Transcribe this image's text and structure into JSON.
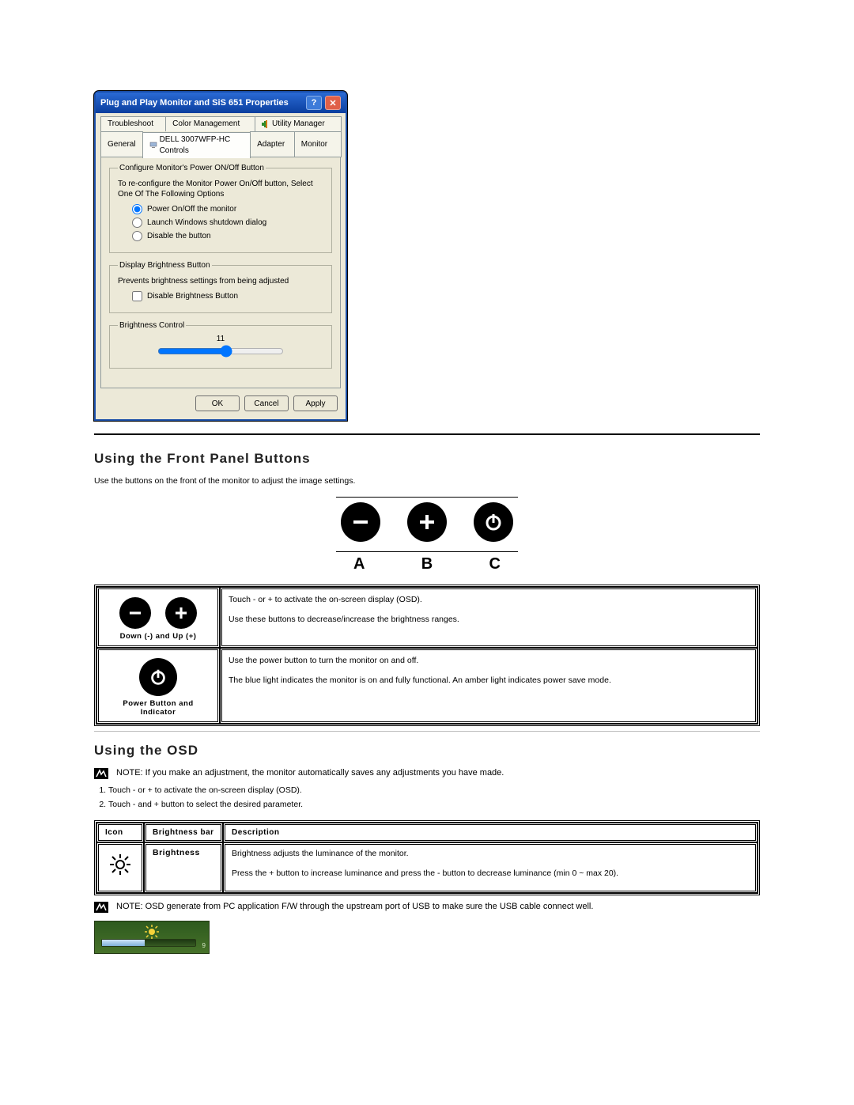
{
  "dialog": {
    "title": "Plug and Play Monitor and SiS 651 Properties",
    "tabs_top": [
      "Troubleshoot",
      "Color Management",
      "Utility Manager"
    ],
    "tabs_bottom": [
      "General",
      "DELL 3007WFP-HC Controls",
      "Adapter",
      "Monitor"
    ],
    "group1": {
      "legend": "Configure Monitor's Power ON/Off Button",
      "desc": "To re-configure the Monitor Power On/Off button, Select One Of The Following Options",
      "opt1": "Power On/Off the monitor",
      "opt2": "Launch Windows shutdown dialog",
      "opt3": "Disable the button"
    },
    "group2": {
      "legend": "Display Brightness Button",
      "desc": "Prevents brightness settings from being adjusted",
      "opt": "Disable Brightness Button"
    },
    "group3": {
      "legend": "Brightness Control",
      "value": "11"
    },
    "buttons": {
      "ok": "OK",
      "cancel": "Cancel",
      "apply": "Apply"
    }
  },
  "section1": {
    "heading": "Using the Front Panel Buttons",
    "intro": "Use the buttons on the front of the monitor to adjust the image settings.",
    "labels": {
      "a": "A",
      "b": "B",
      "c": "C"
    },
    "row1": {
      "caption": "Down (-) and Up (+)",
      "line1": "Touch - or + to activate the on-screen display (OSD).",
      "line2": "Use these buttons to decrease/increase the brightness ranges."
    },
    "row2": {
      "caption": "Power Button and Indicator",
      "line1": "Use the  power button to turn the monitor on and off.",
      "line2": "The blue light  indicates the monitor is on and fully functional. An amber light indicates power save mode."
    }
  },
  "section2": {
    "heading": "Using the OSD",
    "note1": "NOTE: If  you make an adjustment, the monitor automatically saves any adjustments you have made.",
    "step1": "Touch - or + to activate the on-screen display (OSD).",
    "step2": "Touch - and + button to select the desired parameter.",
    "table_headers": {
      "icon": "Icon",
      "bar": "Brightness bar",
      "desc": "Description"
    },
    "table_row": {
      "bar": "Brightness",
      "d1": "Brightness adjusts the  luminance of the monitor.",
      "d2": "Press  the + button to increase luminance and press  the - button to decrease luminance (min 0 ~ max 20)."
    },
    "note2": "NOTE: OSD generate from PC application F/W through the upstream port of USB to make sure the USB cable connect well.",
    "osd_value": "9"
  },
  "chart_data": {
    "type": "bar",
    "title": "Brightness OSD indicator",
    "categories": [
      "Brightness"
    ],
    "values": [
      9
    ],
    "ylim": [
      0,
      20
    ],
    "xlabel": "",
    "ylabel": ""
  }
}
